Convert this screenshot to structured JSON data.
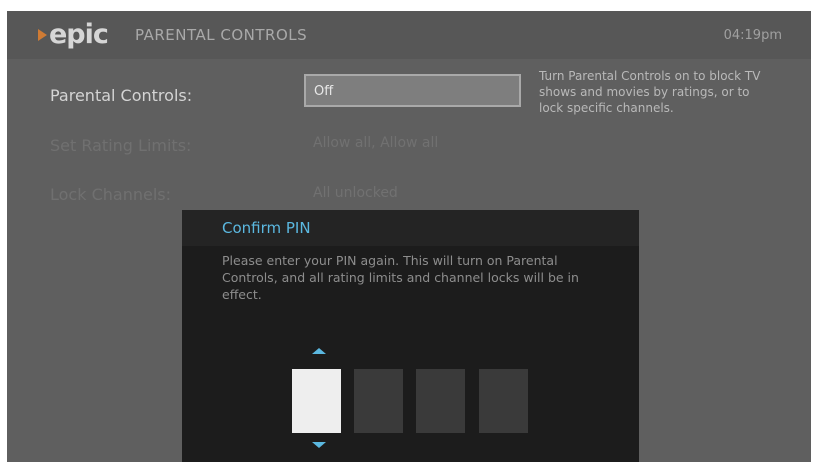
{
  "header": {
    "logo_text": "epic",
    "title": "PARENTAL CONTROLS",
    "time": "04:19pm"
  },
  "settings": {
    "parental_controls": {
      "label": "Parental Controls:",
      "value": "Off"
    },
    "rating_limits": {
      "label": "Set Rating Limits:",
      "value": "Allow all, Allow all"
    },
    "lock_channels": {
      "label": "Lock Channels:",
      "value": "All unlocked"
    }
  },
  "help": {
    "text": "Turn Parental Controls on to block TV shows and movies by ratings, or to lock specific channels."
  },
  "modal": {
    "title": "Confirm PIN",
    "message": "Please enter your PIN again. This will turn on Parental Controls, and all rating limits and channel locks will be in effect.",
    "pin_digits": 4,
    "active_digit": 1
  },
  "colors": {
    "accent": "#5bb8e0",
    "logo_mark": "#cf7b34",
    "background": "#5f5f5f",
    "modal": "#1c1c1c"
  },
  "icons": {
    "logo": "epic-play-mark",
    "up": "caret-up-icon",
    "down": "caret-down-icon"
  }
}
